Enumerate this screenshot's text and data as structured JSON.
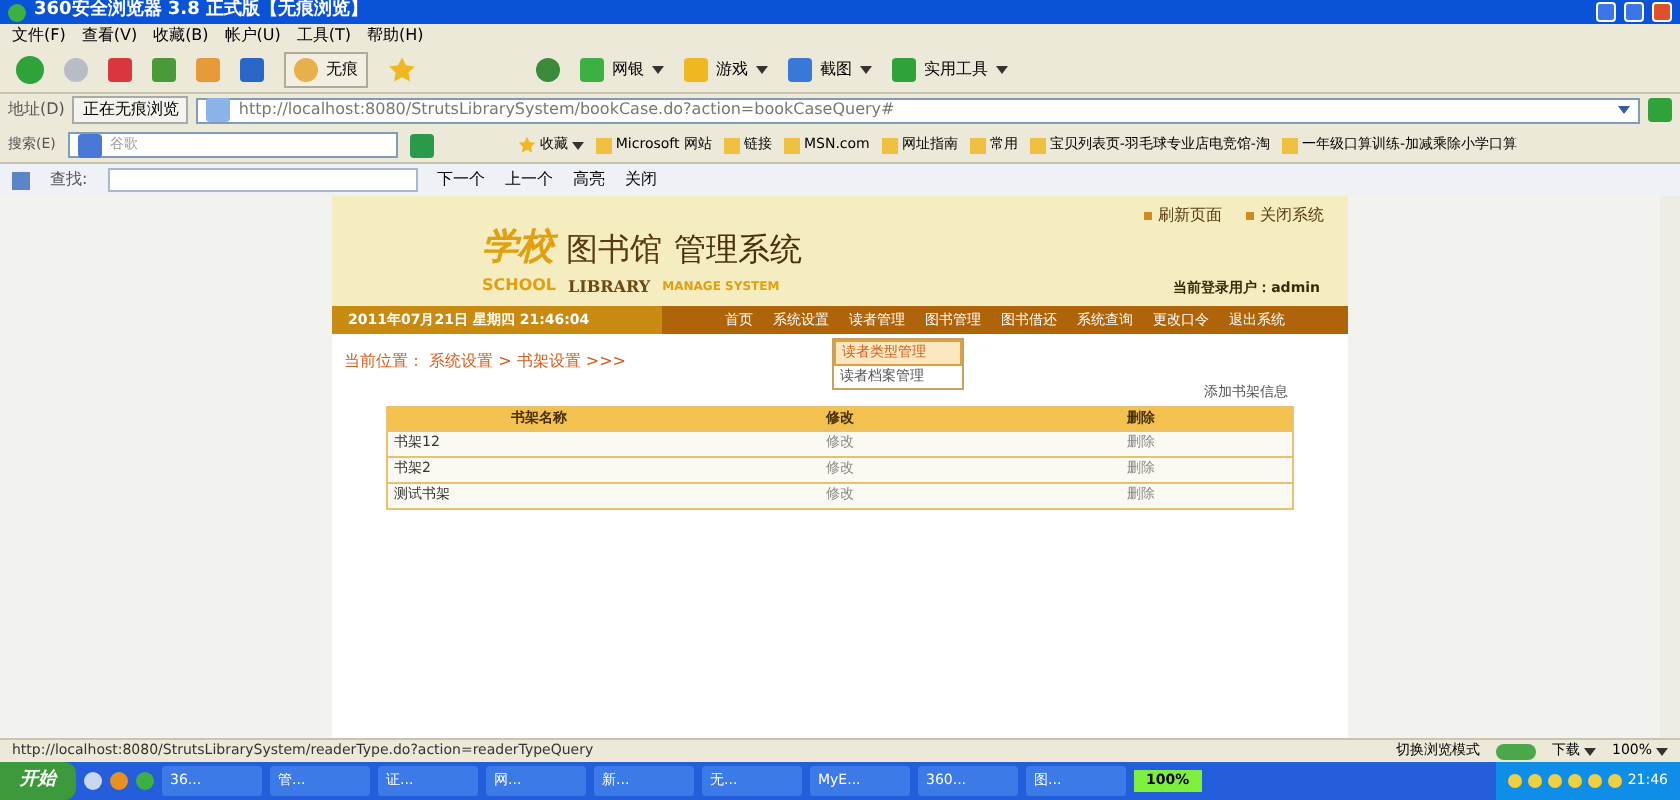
{
  "window": {
    "title": "360安全浏览器 3.8 正式版【无痕浏览】"
  },
  "menu": [
    "文件(F)",
    "查看(V)",
    "收藏(B)",
    "帐户(U)",
    "工具(T)",
    "帮助(H)"
  ],
  "toolbar": {
    "incognito": "无痕",
    "tools": [
      "网银",
      "游戏",
      "截图",
      "实用工具"
    ]
  },
  "address": {
    "label": "地址(D)",
    "mode": "正在无痕浏览",
    "url": "http://localhost:8080/StrutsLibrarySystem/bookCase.do?action=bookCaseQuery#"
  },
  "search_bar": {
    "label": "搜索(E)",
    "engine": "谷歌",
    "favorites": "收藏",
    "links": [
      "Microsoft 网站",
      "链接",
      "MSN.com",
      "网址指南",
      "常用",
      "宝贝列表页-羽毛球专业店电竞馆-淘",
      "一年级口算训练-加减乘除小学口算"
    ]
  },
  "find_bar": {
    "label": "查找:",
    "buttons": [
      "下一个",
      "上一个",
      "高亮",
      "关闭"
    ]
  },
  "page": {
    "title_cn": "学校",
    "title_logo": "图书馆",
    "title_main": "管理系统",
    "subtitle": [
      "SCHOOL",
      "LIBRARY",
      "MANAGE SYSTEM"
    ],
    "top_links": [
      "刷新页面",
      "关闭系统"
    ],
    "user": "当前登录用户：admin",
    "date": "2011年07月21日 星期四 21:46:04",
    "nav": [
      "首页",
      "系统设置",
      "读者管理",
      "图书管理",
      "图书借还",
      "系统查询",
      "更改口令",
      "退出系统"
    ],
    "dropdown": [
      {
        "label": "读者类型管理",
        "selected": true
      },
      {
        "label": "读者档案管理",
        "selected": false
      }
    ],
    "breadcrumb": "当前位置： 系统设置 > 书架设置 >>>",
    "add_link": "添加书架信息",
    "table": {
      "columns": [
        "书架名称",
        "修改",
        "删除"
      ],
      "rows": [
        [
          "书架12",
          "修改",
          "删除"
        ],
        [
          "书架2",
          "修改",
          "删除"
        ],
        [
          "测试书架",
          "修改",
          "删除"
        ]
      ]
    }
  },
  "status_bar": {
    "url": "http://localhost:8080/StrutsLibrarySystem/readerType.do?action=readerTypeQuery",
    "mode": "切换浏览模式",
    "download": "下载",
    "zoom": "100%"
  },
  "taskbar": {
    "start": "开始",
    "tasks": [
      "36...",
      "管...",
      "证...",
      "网...",
      "新...",
      "无...",
      "MyE...",
      "360...",
      "图..."
    ],
    "battery": "100%",
    "clock": "21:46"
  }
}
